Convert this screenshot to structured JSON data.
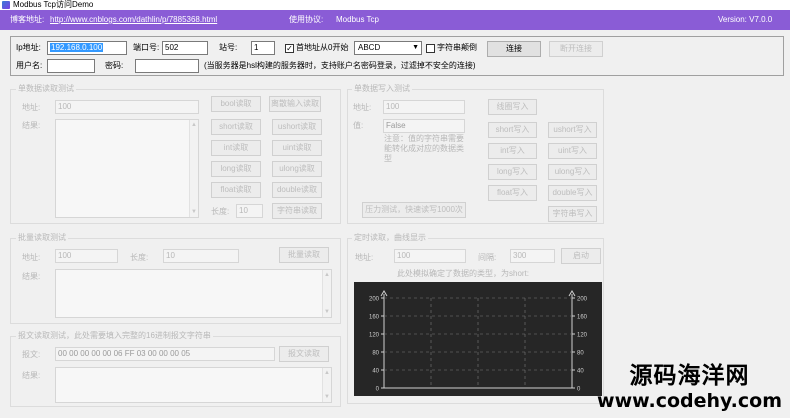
{
  "window": {
    "title": "Modbus Tcp访问Demo",
    "icon": "app-icon"
  },
  "banner": {
    "blog_label": "博客地址:",
    "blog_url": "http://www.cnblogs.com/dathlin/p/7885368.html",
    "protocol_label": "使用协议:",
    "protocol_value": "Modbus Tcp",
    "version": "Version: V7.0.0"
  },
  "connection": {
    "ip_label": "Ip地址:",
    "ip_value": "192.168.0.100",
    "port_label": "端口号:",
    "port_value": "502",
    "station_label": "站号:",
    "station_value": "1",
    "start_zero_checked": true,
    "start_zero_label": "首地址从0开始",
    "format_value": "ABCD",
    "string_reverse_checked": false,
    "string_reverse_label": "字符串颠倒",
    "connect_label": "连接",
    "disconnect_label": "断开连接",
    "user_label": "用户名:",
    "user_value": "",
    "password_label": "密码:",
    "password_value": "",
    "note": "(当服务器是hsl构建的服务器时，支持账户名密码登录，过滤掉不安全的连接)"
  },
  "single_read": {
    "title": "单数据读取测试",
    "address_label": "地址:",
    "address_value": "100",
    "result_label": "结果:",
    "length_label": "长度:",
    "length_value": "10",
    "buttons": [
      "bool读取",
      "离散输入读取",
      "short读取",
      "ushort读取",
      "int读取",
      "uint读取",
      "long读取",
      "ulong读取",
      "float读取",
      "double读取",
      "字符串读取"
    ]
  },
  "single_write": {
    "title": "单数据写入测试",
    "address_label": "地址:",
    "address_value": "100",
    "value_label": "值:",
    "value_value": "False",
    "note": "注意：值的字符串需要能转化成对应的数据类型",
    "buttons": [
      "线圈写入",
      "short写入",
      "ushort写入",
      "int写入",
      "uint写入",
      "long写入",
      "ulong写入",
      "float写入",
      "double写入",
      "字符串写入"
    ],
    "stress_label": "压力测试，快速读写1000次"
  },
  "batch_read": {
    "title": "批量读取测试",
    "address_label": "地址:",
    "address_value": "100",
    "length_label": "长度:",
    "length_value": "10",
    "read_label": "批量读取",
    "result_label": "结果:"
  },
  "message_read": {
    "title": "报文读取测试，此处需要填入完整的16进制报文字符串",
    "message_label": "报文:",
    "message_value": "00 00 00 00 00 06 FF 03 00 00 00 05",
    "send_label": "报文读取",
    "result_label": "结果:"
  },
  "timed_read": {
    "title": "定时读取，曲线显示",
    "address_label": "地址:",
    "address_value": "100",
    "interval_label": "间隔:",
    "interval_value": "300",
    "start_label": "启动",
    "note": "此处模拟确定了数据的类型，为short:"
  },
  "chart_data": {
    "type": "line",
    "title": "",
    "xlabel": "",
    "ylabel": "",
    "ylim": [
      0,
      200
    ],
    "yticks_left": [
      "200",
      "160",
      "120",
      "80",
      "40",
      "0"
    ],
    "yticks_right": [
      "200",
      "160",
      "120",
      "80",
      "40",
      "0"
    ],
    "grid": true,
    "series": []
  },
  "colors": {
    "banner": "#8a5cd6",
    "selection": "#3399ff",
    "chart_bg": "#262626"
  },
  "watermark": {
    "cn": "源码海洋网",
    "url": "www.codehy.com"
  }
}
